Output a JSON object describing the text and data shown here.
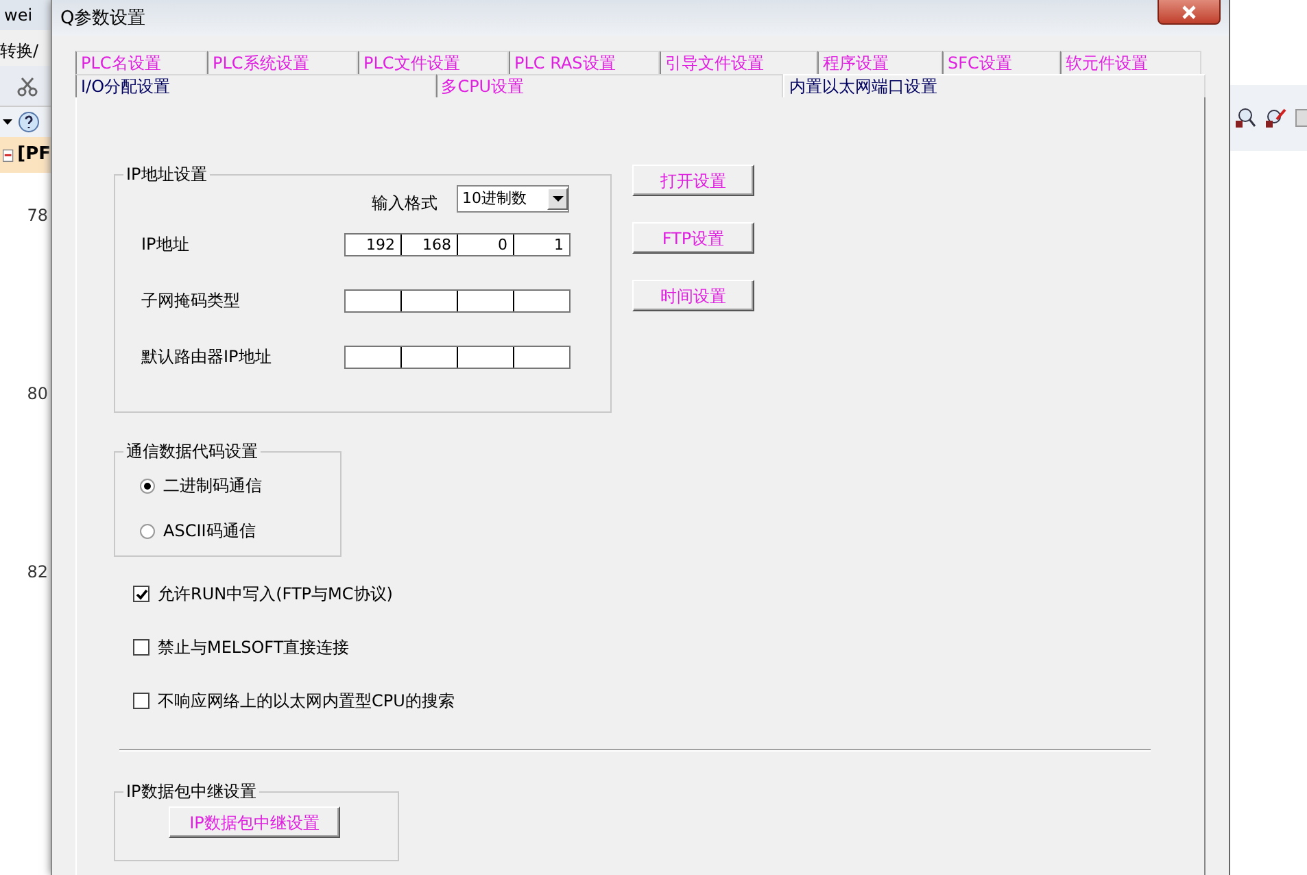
{
  "background_app": {
    "title_fragment": "wei",
    "menu_fragment": "转换/",
    "tab_fragment": "[PF",
    "line_numbers": [
      "78",
      "80",
      "82"
    ]
  },
  "window": {
    "title": "Q参数设置"
  },
  "tabs_row_1": [
    {
      "label": "PLC名设置",
      "selected": false,
      "color": "#e020e0"
    },
    {
      "label": "PLC系统设置",
      "selected": false,
      "color": "#e020e0"
    },
    {
      "label": "PLC文件设置",
      "selected": false,
      "color": "#e020e0"
    },
    {
      "label": "PLC RAS设置",
      "selected": false,
      "color": "#e020e0"
    },
    {
      "label": "引导文件设置",
      "selected": false,
      "color": "#e020e0"
    },
    {
      "label": "程序设置",
      "selected": false,
      "color": "#e020e0"
    },
    {
      "label": "SFC设置",
      "selected": false,
      "color": "#e020e0"
    },
    {
      "label": "软元件设置",
      "selected": false,
      "color": "#e020e0"
    }
  ],
  "tabs_row_2": [
    {
      "label": "I/O分配设置",
      "selected": false,
      "color": "#000060"
    },
    {
      "label": "多CPU设置",
      "selected": false,
      "color": "#e020e0"
    },
    {
      "label": "内置以太网端口设置",
      "selected": true,
      "color": "#000060"
    }
  ],
  "ip_group": {
    "title": "IP地址设置",
    "input_format": {
      "label": "输入格式",
      "value": "10进制数"
    },
    "fields": [
      {
        "label": "IP地址",
        "octets": [
          "192",
          "168",
          "0",
          "1"
        ]
      },
      {
        "label": "子网掩码类型"
      },
      {
        "label": "默认路由器IP地址"
      }
    ]
  },
  "side_buttons": [
    "打开设置",
    "FTP设置",
    "时间设置"
  ],
  "code_group": {
    "title": "通信数据代码设置",
    "options": [
      {
        "label": "二进制码通信",
        "selected": true
      },
      {
        "label": "ASCII码通信",
        "selected": false
      }
    ]
  },
  "checkboxes": [
    {
      "label": "允许RUN中写入(FTP与MC协议)",
      "checked": true
    },
    {
      "label": "禁止与MELSOFT直接连接",
      "checked": false
    },
    {
      "label": "不响应网络上的以太网内置型CPU的搜索",
      "checked": false
    }
  ],
  "relay_group": {
    "title": "IP数据包中继设置",
    "button": "IP数据包中继设置"
  }
}
